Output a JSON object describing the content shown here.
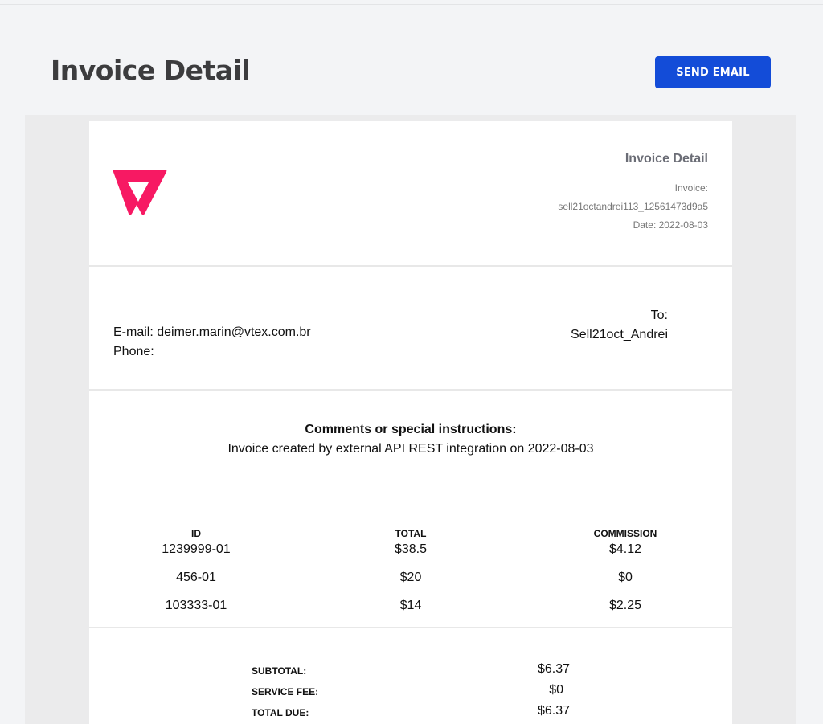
{
  "header": {
    "title": "Invoice Detail",
    "send_email_label": "SEND EMAIL"
  },
  "invoice": {
    "title": "Invoice Detail",
    "invoice_label": "Invoice:",
    "invoice_id": "sell21octandrei113_12561473d9a5",
    "date": "Date: 2022-08-03",
    "brand_color": "#f71963"
  },
  "contact": {
    "email": "E-mail: deimer.marin@vtex.com.br",
    "phone": "Phone:"
  },
  "recipient": {
    "to_label": "To:",
    "name": "Sell21oct_Andrei"
  },
  "comments": {
    "heading": "Comments or special instructions:",
    "text": "Invoice created by external API REST integration on 2022-08-03"
  },
  "table": {
    "columns": [
      "ID",
      "TOTAL",
      "COMMISSION"
    ],
    "rows": [
      [
        "1239999-01",
        "$38.5",
        "$4.12"
      ],
      [
        "456-01",
        "$20",
        "$0"
      ],
      [
        "103333-01",
        "$14",
        "$2.25"
      ]
    ]
  },
  "totals": {
    "subtotal_label": "SUBTOTAL:",
    "subtotal_value": "$6.37",
    "fee_label": "SERVICE FEE:",
    "fee_value": "$0",
    "due_label": "TOTAL DUE:",
    "due_value": "$6.37"
  }
}
